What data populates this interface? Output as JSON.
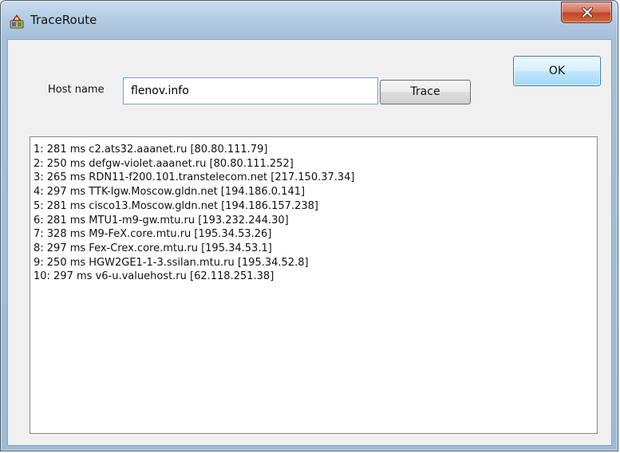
{
  "window": {
    "title": "TraceRoute",
    "close_icon": "close-icon",
    "app_icon": "app-icon"
  },
  "form": {
    "host_label": "Host name",
    "host_value": "flenov.info",
    "trace_label": "Trace",
    "ok_label": "OK"
  },
  "results": [
    "1: 281 ms c2.ats32.aaanet.ru [80.80.111.79]",
    "2: 250 ms defgw-violet.aaanet.ru [80.80.111.252]",
    "3: 265 ms RDN11-f200.101.transtelecom.net [217.150.37.34]",
    "4: 297 ms TTK-lgw.Moscow.gldn.net [194.186.0.141]",
    "5: 281 ms cisco13.Moscow.gldn.net [194.186.157.238]",
    "6: 281 ms MTU1-m9-gw.mtu.ru [193.232.244.30]",
    "7: 328 ms M9-FeX.core.mtu.ru [195.34.53.26]",
    "8: 297 ms Fex-Crex.core.mtu.ru [195.34.53.1]",
    "9: 250 ms HGW2GE1-1-3.ssilan.mtu.ru [195.34.52.8]",
    "10: 297 ms v6-u.valuehost.ru [62.118.251.38]"
  ],
  "colors": {
    "frame": "#a4c0da",
    "client": "#f0f0f0",
    "close_button": "#c0442b",
    "default_button": "#bee6fd"
  }
}
